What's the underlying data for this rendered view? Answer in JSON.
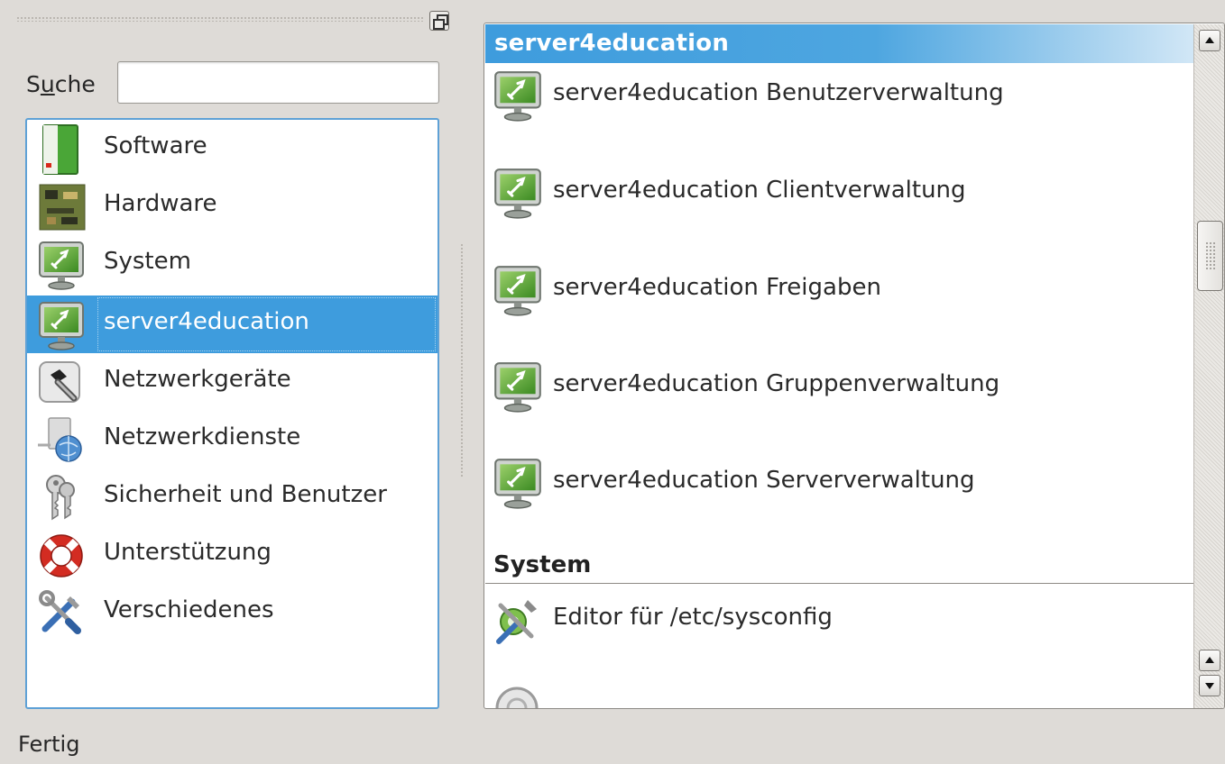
{
  "search": {
    "label_pre": "S",
    "label_accel": "u",
    "label_post": "che",
    "value": ""
  },
  "categories": [
    {
      "label": "Software",
      "icon": "software-package-icon"
    },
    {
      "label": "Hardware",
      "icon": "circuit-board-icon"
    },
    {
      "label": "System",
      "icon": "monitor-icon"
    },
    {
      "label": "server4education",
      "icon": "monitor-icon",
      "selected": true
    },
    {
      "label": "Netzwerkgeräte",
      "icon": "network-card-icon"
    },
    {
      "label": "Netzwerkdienste",
      "icon": "globe-server-icon"
    },
    {
      "label": "Sicherheit und Benutzer",
      "icon": "keys-icon"
    },
    {
      "label": "Unterstützung",
      "icon": "lifebuoy-icon"
    },
    {
      "label": "Verschiedenes",
      "icon": "tools-icon"
    }
  ],
  "groups": [
    {
      "title": "server4education",
      "items": [
        {
          "label": "server4education Benutzerverwaltung",
          "icon": "monitor-icon"
        },
        {
          "label": "server4education Clientverwaltung",
          "icon": "monitor-icon"
        },
        {
          "label": "server4education Freigaben",
          "icon": "monitor-icon"
        },
        {
          "label": "server4education Gruppenverwaltung",
          "icon": "monitor-icon"
        },
        {
          "label": "server4education Serververwaltung",
          "icon": "monitor-icon"
        }
      ]
    },
    {
      "title": "System",
      "items": [
        {
          "label": "Editor für /etc/sysconfig",
          "icon": "sysconfig-editor-icon"
        },
        {
          "label": "",
          "icon": "gear-icon"
        }
      ]
    }
  ],
  "status_text": "Fertig",
  "colors": {
    "selection": "#3e9cdd",
    "window_bg": "#dedbd7",
    "focus_border": "#5ea1d6"
  }
}
